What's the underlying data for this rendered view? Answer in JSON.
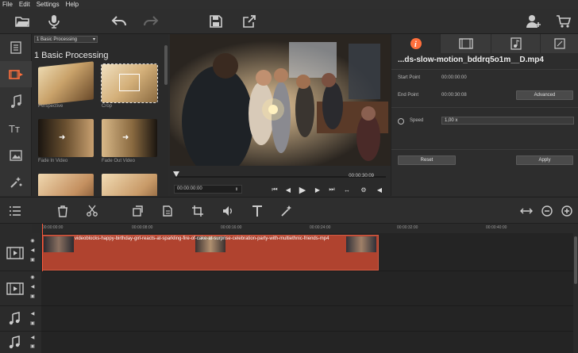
{
  "menu": [
    "File",
    "Edit",
    "Settings",
    "Help"
  ],
  "toolbar": {
    "icons": [
      "open-folder-icon",
      "microphone-icon",
      "undo-icon",
      "redo-icon",
      "save-icon",
      "export-icon",
      "add-user-icon",
      "cart-icon"
    ]
  },
  "sidebar": {
    "items": [
      "media-files",
      "transitions",
      "music",
      "titles",
      "stickers",
      "filters"
    ]
  },
  "effects": {
    "category": "1 Basic Processing",
    "title": "1 Basic Processing",
    "items": [
      {
        "label": "Perspective"
      },
      {
        "label": "Crop"
      },
      {
        "label": "Fade In Video"
      },
      {
        "label": "Fade Out Video"
      },
      {
        "label": ""
      },
      {
        "label": ""
      }
    ]
  },
  "player": {
    "current_time": "00:00:00:00",
    "total_time": "00:00:30:09",
    "progress": 0.0
  },
  "properties": {
    "filename": "...ds-slow-motion_bddrq5o1m__D.mp4",
    "start_label": "Start Point",
    "start_value": "00:00:00:00",
    "end_label": "End Point",
    "end_value": "00:00:30:08",
    "advanced": "Advanced",
    "speed_label": "Speed",
    "speed_value": "1,00 x",
    "reset": "Reset",
    "apply": "Apply"
  },
  "timeline": {
    "ticks": [
      "00:00:00:00",
      "00:00:08:00",
      "00:00:16:00",
      "00:00:24:00",
      "00:00:32:00",
      "00:00:40:00"
    ],
    "clip_name": "videoblocks-happy-birthday-girl-reacts-at-sparkling-fire-of-cake-at-surprise-celebration-party-with-multiethnic-friends-mp4"
  },
  "colors": {
    "clip": "#b0432f",
    "accent": "#ff6f3c",
    "playhead": "#ff5a3c"
  }
}
